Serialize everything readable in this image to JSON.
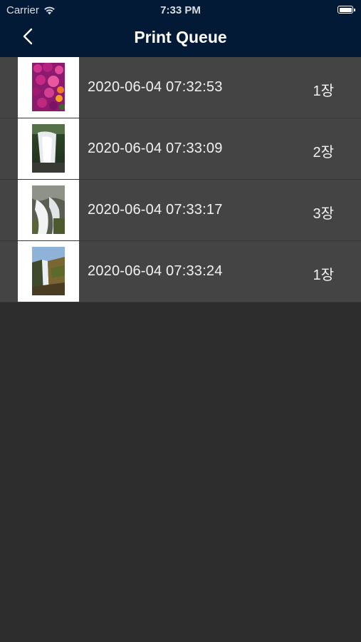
{
  "status_bar": {
    "carrier": "Carrier",
    "time": "7:33 PM"
  },
  "nav": {
    "title": "Print Queue",
    "back_icon": "chevron-left-icon"
  },
  "queue": [
    {
      "date": "2020-06-04 07:32:53",
      "count": "1장",
      "thumbnail": "flowers-photo"
    },
    {
      "date": "2020-06-04 07:33:09",
      "count": "2장",
      "thumbnail": "waterfall-photo"
    },
    {
      "date": "2020-06-04 07:33:17",
      "count": "3장",
      "thumbnail": "waterfall-rocks-photo"
    },
    {
      "date": "2020-06-04 07:33:24",
      "count": "1장",
      "thumbnail": "cliff-waterfall-photo"
    }
  ],
  "colors": {
    "header_bg": "#021a36",
    "row_bg": "#444444",
    "page_bg": "#2d2d2d",
    "text": "#f2f2f2"
  }
}
